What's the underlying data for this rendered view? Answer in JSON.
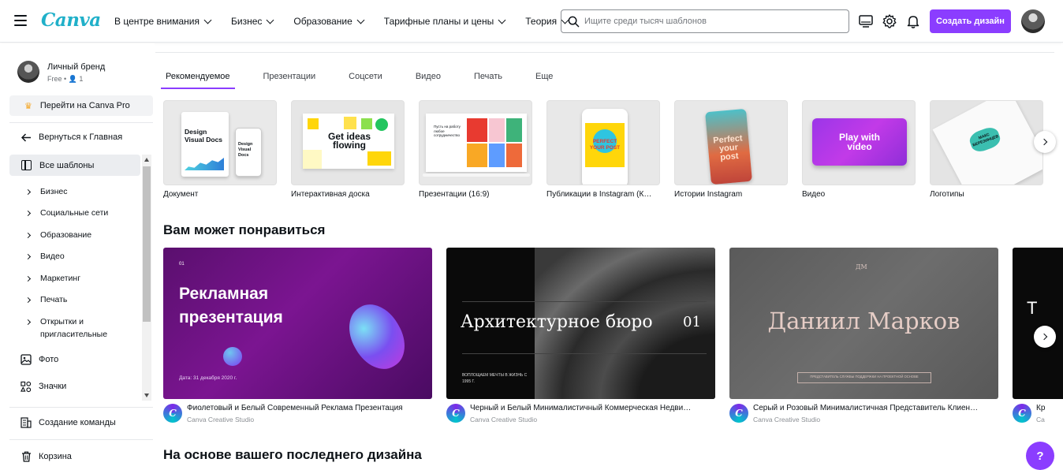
{
  "header": {
    "logo": "Canva",
    "nav": [
      "В центре внимания",
      "Бизнес",
      "Образование",
      "Тарифные планы и цены",
      "Теория"
    ],
    "search_placeholder": "Ищите среди тысяч шаблонов",
    "create_label": "Создать дизайн",
    "icons": [
      "desktop-icon",
      "gear-icon",
      "bell-icon"
    ]
  },
  "sidebar": {
    "profile_name": "Личный бренд",
    "profile_plan": "Free • 👤 1",
    "pro_label": "Перейти на Canva Pro",
    "back_label": "Вернуться к Главная",
    "all_templates": "Все шаблоны",
    "categories": [
      "Бизнес",
      "Социальные сети",
      "Образование",
      "Видео",
      "Маркетинг",
      "Печать",
      "Открытки и пригласительные"
    ],
    "photos": "Фото",
    "icons_label": "Значки",
    "team": "Создание команды",
    "trash": "Корзина"
  },
  "tabs": [
    "Рекомендуемое",
    "Презентации",
    "Соцсети",
    "Видео",
    "Печать",
    "Еще"
  ],
  "types": [
    {
      "label": "Документ",
      "thumb_text": "Design Visual Docs"
    },
    {
      "label": "Интерактивная доска",
      "thumb_text": "Get ideas flowing"
    },
    {
      "label": "Презентации (16:9)",
      "thumb_text": "Пусть на работу любое сотрудничество"
    },
    {
      "label": "Публикации в Instagram (К…",
      "thumb_text": "PERFECT YOUR POST"
    },
    {
      "label": "Истории Instagram",
      "thumb_text": "Perfect your post"
    },
    {
      "label": "Видео",
      "thumb_text": "Play with video"
    },
    {
      "label": "Логотипы",
      "thumb_text": "МАКС БЕРЕЗИНЦЕВ"
    }
  ],
  "sections": {
    "recommended": "Вам может понравиться",
    "based_on": "На основе вашего последнего дизайна"
  },
  "templates": [
    {
      "title": "Фиолетовый и Белый Современный Реклама Презентация",
      "author": "Canva Creative Studio",
      "thumb_heading": "Рекламная презентация",
      "thumb_date": "Дата: 31 декабря 2020 г.",
      "thumb_num": "01"
    },
    {
      "title": "Черный и Белый Минималистичный Коммерческая Недви…",
      "author": "Canva Creative Studio",
      "thumb_heading": "Архитектурное бюро",
      "thumb_num": "01",
      "thumb_sub": "ВОПЛОЩАЕМ МЕЧТЫ В ЖИЗНЬ С 1995 Г."
    },
    {
      "title": "Серый и Розовый Минималистичная Представитель Клиен…",
      "author": "Canva Creative Studio",
      "thumb_heading": "Даниил Марков",
      "thumb_mono": "ДМ",
      "thumb_sub": "ПРЕДСТАВИТЕЛЬ СЛУЖБЫ ПОДДЕРЖКИ НА ПРОЕКТНОЙ ОСНОВЕ"
    },
    {
      "title": "Кр",
      "author": "Ca",
      "thumb_heading": "Т"
    }
  ],
  "help_label": "?"
}
